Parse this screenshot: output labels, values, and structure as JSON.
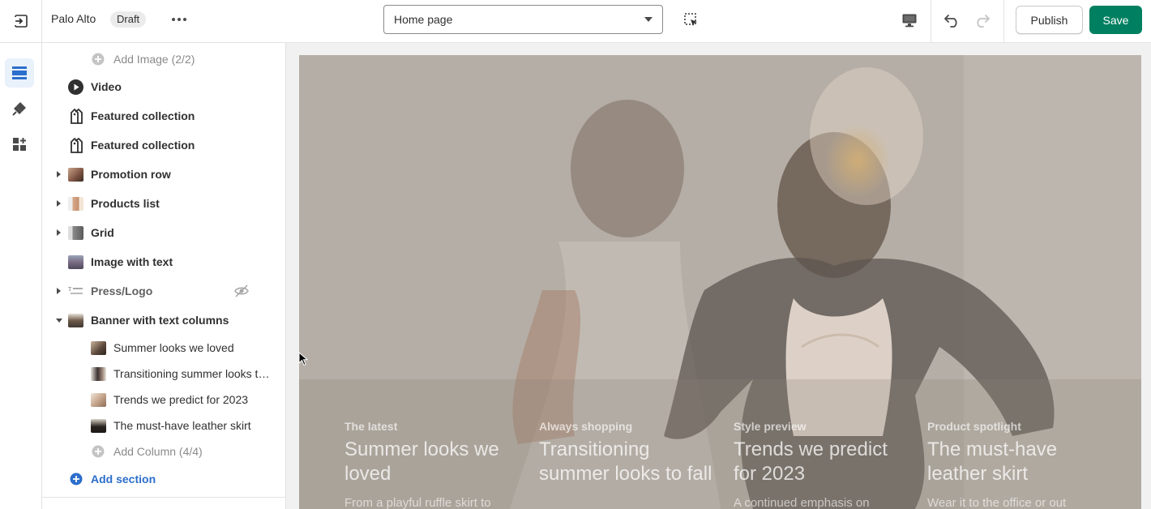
{
  "topbar": {
    "store_name": "Palo Alto",
    "status_badge": "Draft",
    "page_selector_value": "Home page",
    "publish_label": "Publish",
    "save_label": "Save"
  },
  "colors": {
    "accent": "#2c6ecb",
    "save_green": "#008060",
    "rail_active": "#e9f1fb"
  },
  "rail": {
    "items": [
      {
        "icon": "sections-icon",
        "active": true
      },
      {
        "icon": "theme-settings-brush-icon",
        "active": false
      },
      {
        "icon": "app-blocks-icon",
        "active": false
      }
    ]
  },
  "sidebar": {
    "add_image": "Add Image (2/2)",
    "sections": [
      {
        "label": "Video",
        "icon": "play-circle-icon"
      },
      {
        "label": "Featured collection",
        "icon": "tag-collection-icon"
      },
      {
        "label": "Featured collection",
        "icon": "tag-collection-icon"
      },
      {
        "label": "Promotion row",
        "icon": "promotion-thumbnail"
      },
      {
        "label": "Products list",
        "icon": "products-thumbnail"
      },
      {
        "label": "Grid",
        "icon": "grid-thumbnail"
      },
      {
        "label": "Image with text",
        "icon": "image-thumbnail"
      },
      {
        "label": "Press/Logo",
        "icon": "press-logo-thumbnail",
        "hidden": true
      },
      {
        "label": "Banner with text columns",
        "icon": "banner-thumbnail",
        "expanded": true
      }
    ],
    "banner_blocks": [
      {
        "label": "Summer looks we loved"
      },
      {
        "label": "Transitioning summer looks to fall"
      },
      {
        "label": "Trends we predict for 2023"
      },
      {
        "label": "The must-have leather skirt"
      }
    ],
    "add_column": "Add Column (4/4)",
    "add_section": "Add section"
  },
  "preview": {
    "columns": [
      {
        "eyebrow": "The latest",
        "heading": "Summer looks we loved",
        "body": "From a playful ruffle skirt to"
      },
      {
        "eyebrow": "Always shopping",
        "heading": "Transitioning summer looks to fall",
        "body": ""
      },
      {
        "eyebrow": "Style preview",
        "heading": "Trends we predict for 2023",
        "body": "A continued emphasis on"
      },
      {
        "eyebrow": "Product spotlight",
        "heading": "The must-have leather skirt",
        "body": "Wear it to the office or out"
      }
    ]
  }
}
